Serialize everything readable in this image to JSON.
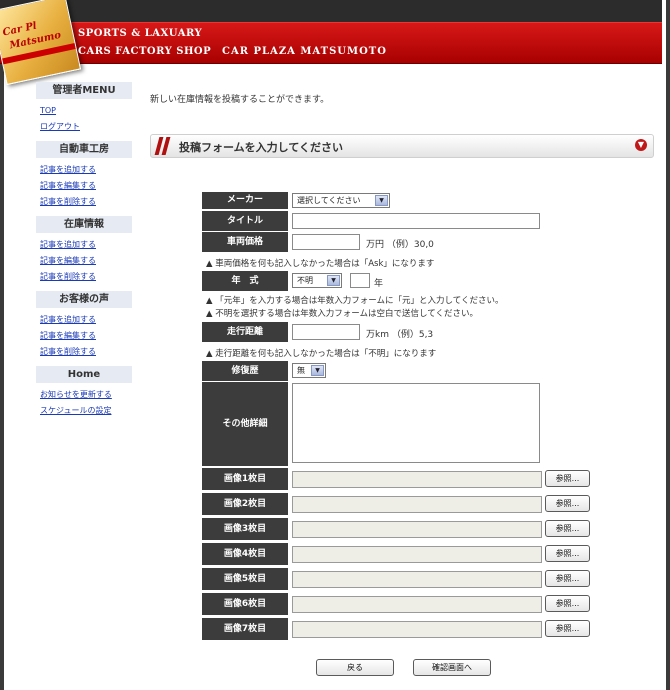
{
  "header": {
    "logo_text_1": "Car Pl",
    "logo_text_2": "Matsumo",
    "brand_line_1": "SPORTS & LAXUARY",
    "brand_line_2": "CARS FACTORY SHOP",
    "brand_line_3": "CAR PLAZA MATSUMOTO"
  },
  "sidebar": {
    "groups": [
      {
        "title": "管理者MENU",
        "links": [
          "TOP",
          "ログアウト"
        ]
      },
      {
        "title": "自動車工房",
        "links": [
          "記事を追加する",
          "記事を編集する",
          "記事を削除する"
        ]
      },
      {
        "title": "在庫情報",
        "links": [
          "記事を追加する",
          "記事を編集する",
          "記事を削除する"
        ]
      },
      {
        "title": "お客様の声",
        "links": [
          "記事を追加する",
          "記事を編集する",
          "記事を削除する"
        ]
      },
      {
        "title": "Home",
        "links": [
          "お知らせを更新する",
          "スケジュールの設定"
        ]
      }
    ]
  },
  "main": {
    "intro": "新しい在庫情報を投稿することができます。",
    "form_title": "投稿フォームを入力してください",
    "toggle_icon": "▼"
  },
  "form": {
    "maker_label": "メーカー",
    "maker_value": "選択してください",
    "title_label": "タイトル",
    "title_value": "",
    "price_label": "車両価格",
    "price_value": "",
    "price_unit": "万円 （例）30,0",
    "price_note": "▲ 車両価格を何も記入しなかった場合は「Ask」になります",
    "year_label": "年　式",
    "year_value": "不明",
    "year_input": "",
    "year_unit": "年",
    "year_note_1": "▲ 「元年」を入力する場合は年数入力フォームに「元」と入力してください。",
    "year_note_2": "▲ 不明を選択する場合は年数入力フォームは空白で送信してください。",
    "mileage_label": "走行距離",
    "mileage_value": "",
    "mileage_unit": "万km （例）5,3",
    "mileage_note": "▲ 走行距離を何も記入しなかった場合は「不明」になります",
    "repair_label": "修復歴",
    "repair_value": "無",
    "details_label": "その他詳細",
    "browse_label": "参照...",
    "images": [
      "画像1枚目",
      "画像2枚目",
      "画像3枚目",
      "画像4枚目",
      "画像5枚目",
      "画像6枚目",
      "画像7枚目"
    ],
    "back_button": "戻る",
    "confirm_button": "確認画面へ"
  }
}
